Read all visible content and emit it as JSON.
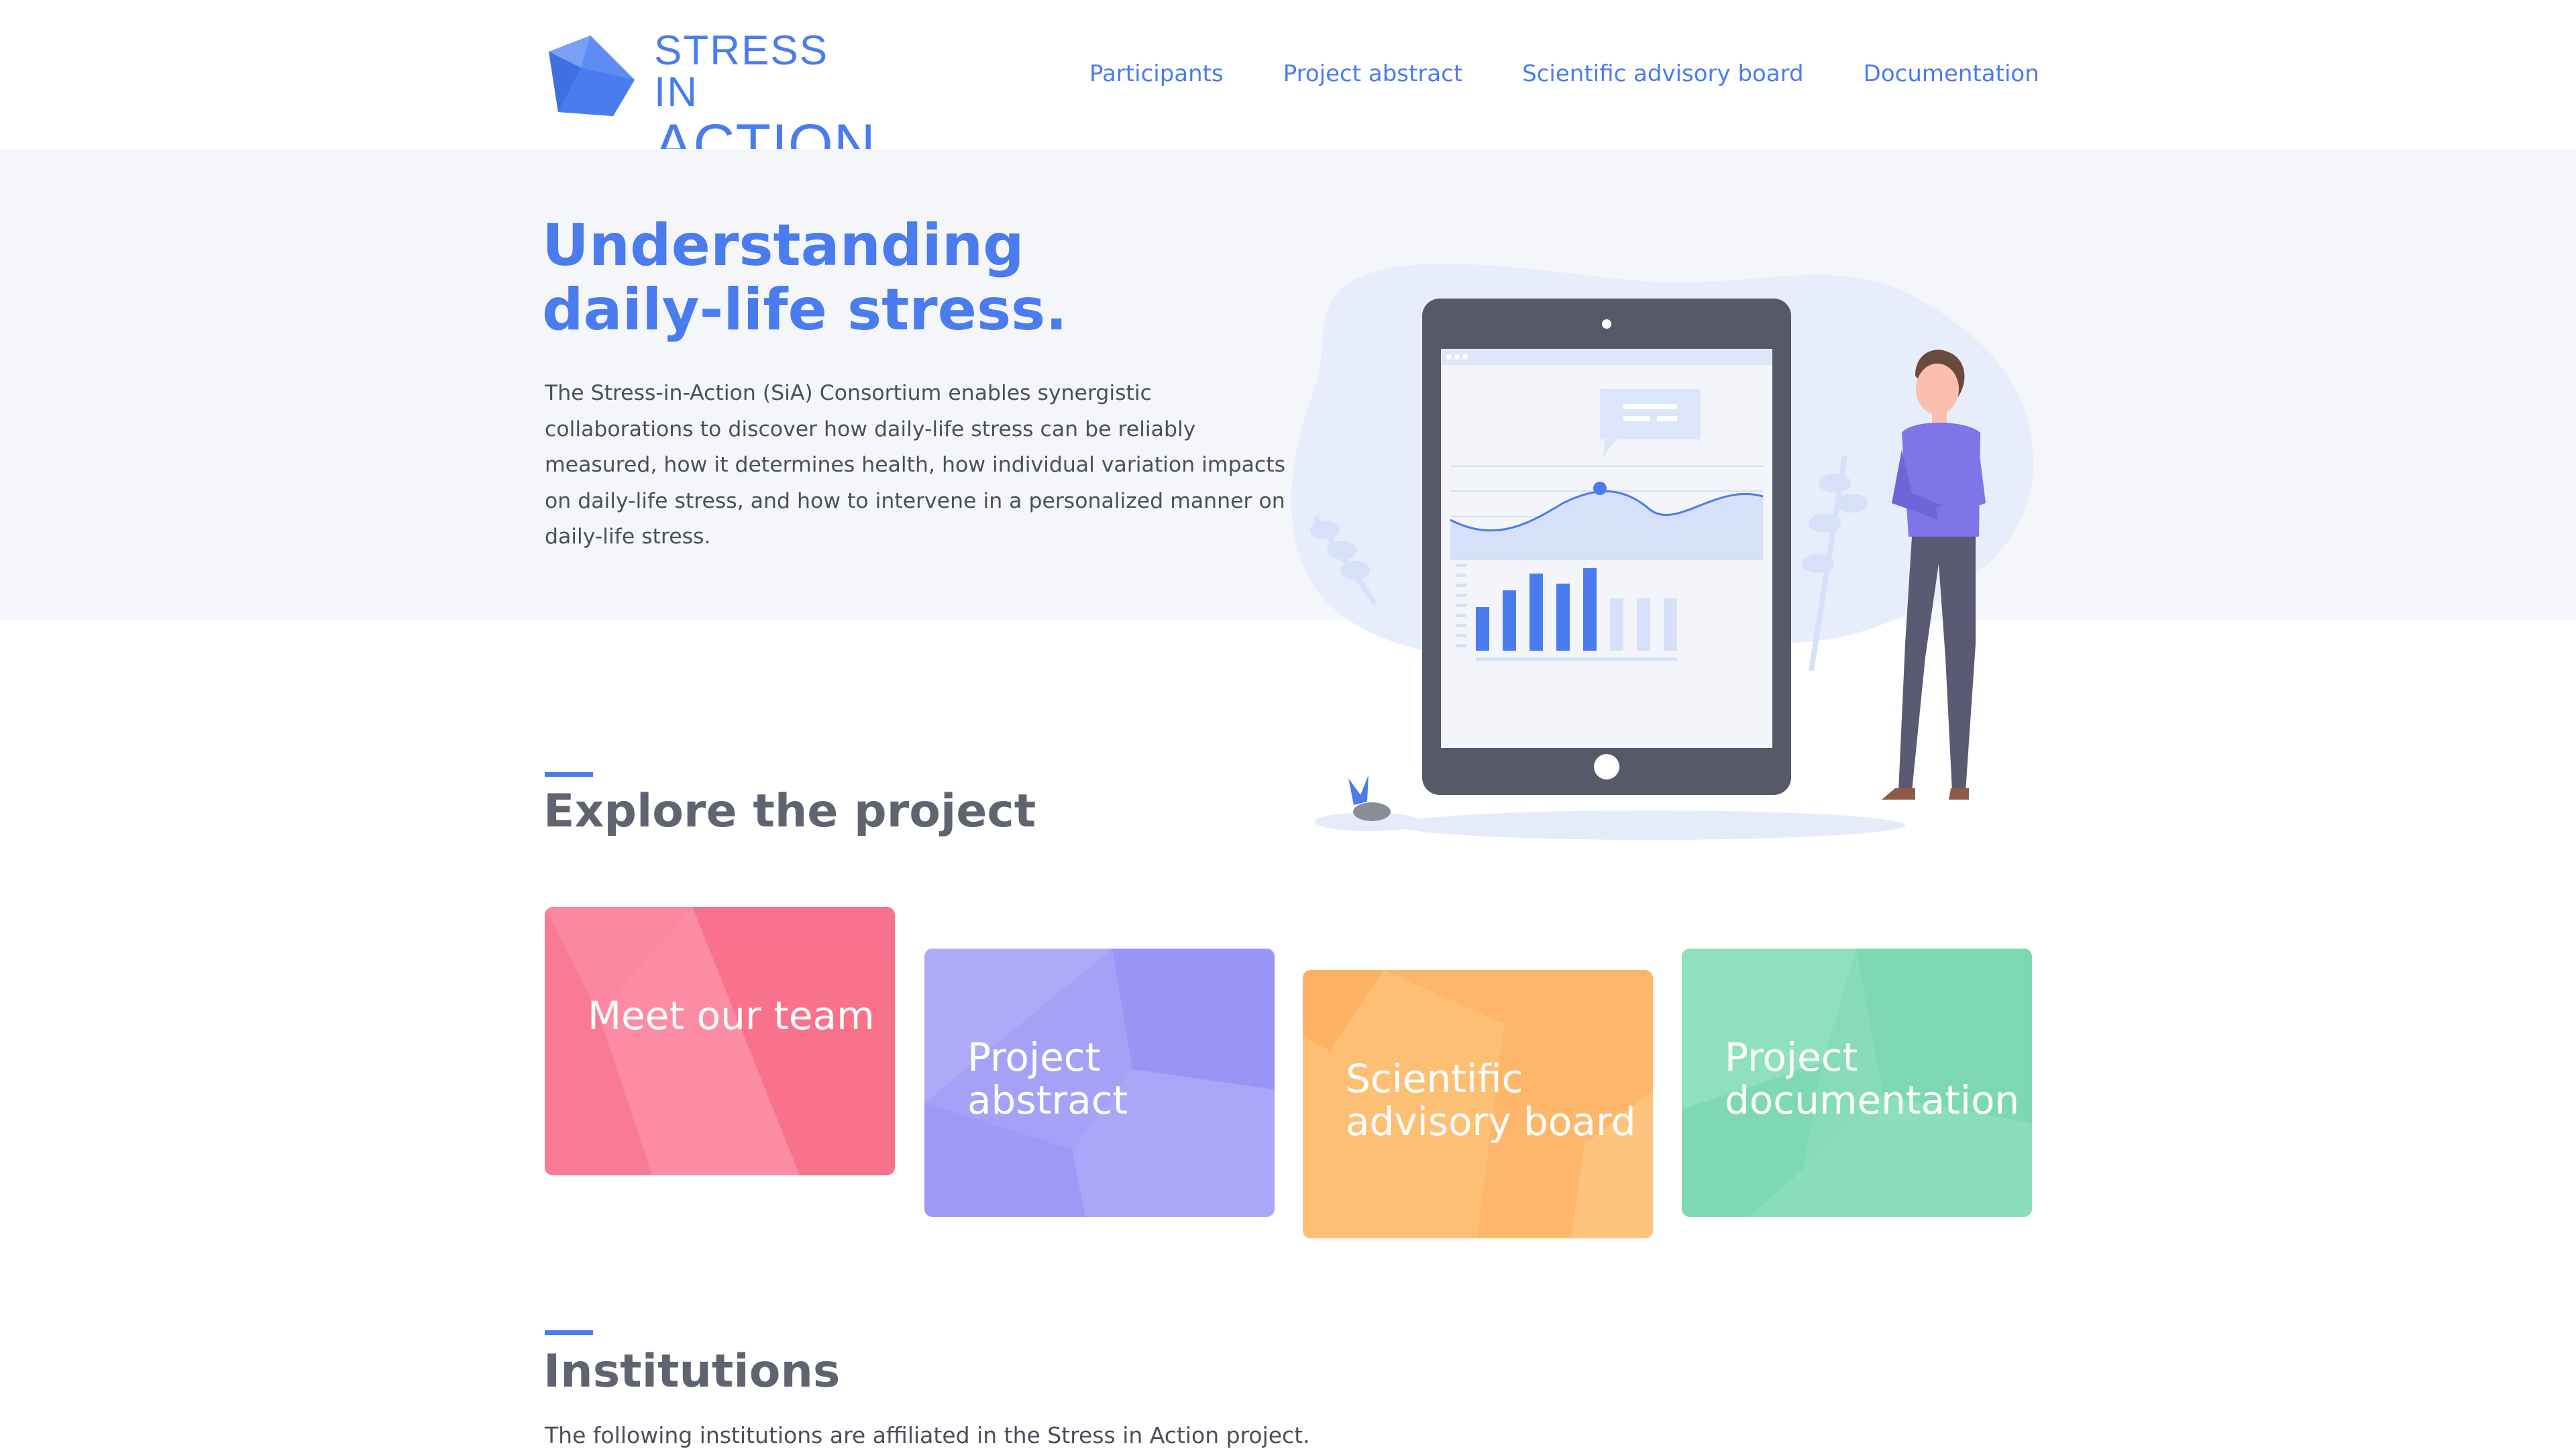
{
  "brand": {
    "line1": "STRESS IN",
    "line2": "ACTION",
    "color": "#4a7cf0",
    "icon": "polyhedron-logo-icon"
  },
  "nav": {
    "items": [
      {
        "label": "Participants"
      },
      {
        "label": "Project abstract"
      },
      {
        "label": "Scientific advisory board"
      },
      {
        "label": "Documentation"
      }
    ]
  },
  "hero": {
    "title_line1": "Understanding",
    "title_line2": "daily-life stress.",
    "text": "The Stress-in-Action (SiA) Consortium enables synergistic collaborations to discover how daily-life stress can be reliably measured, how it determines health, how individual variation impacts on daily-life stress, and how to intervene in a personalized manner on daily-life stress."
  },
  "explore": {
    "title": "Explore the project",
    "cards": [
      {
        "label": "Meet our team",
        "color": "#f97b93"
      },
      {
        "label": "Project abstract",
        "color": "#a39ff7"
      },
      {
        "label": "Scientific advisory board",
        "color": "#fdbb6c"
      },
      {
        "label": "Project documentation",
        "color": "#84dcb8"
      }
    ]
  },
  "institutions": {
    "title": "Institutions",
    "text": "The following institutions are affiliated in the Stress in Action project."
  },
  "colors": {
    "accent": "#4a7cf0",
    "hero_band": "#f5f6fa",
    "tablet": "#565a68"
  }
}
